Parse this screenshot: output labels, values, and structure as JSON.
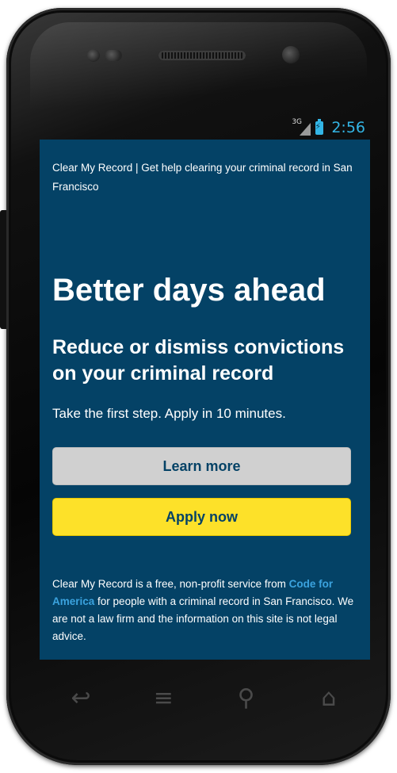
{
  "status_bar": {
    "network_label": "3G",
    "time": "2:56"
  },
  "page": {
    "top_line": "Clear My Record | Get help clearing your criminal record in San Francisco",
    "headline": "Better days ahead",
    "subheadline": "Reduce or dismiss convictions on your criminal record",
    "lead": "Take the first step. Apply in 10 minutes.",
    "buttons": {
      "learn_more": "Learn more",
      "apply_now": "Apply now"
    },
    "footer": {
      "before_link": "Clear My Record is a free, non-profit service from ",
      "link_text": "Code for America",
      "after_link": " for people with a criminal record in San Francisco. We are not a law firm and the information on this site is not legal advice."
    }
  },
  "nav_bar": {
    "icons": [
      "back-icon",
      "menu-icon",
      "search-icon",
      "home-icon"
    ]
  },
  "colors": {
    "screen_background": "#044266",
    "apply_button": "#fde129",
    "learn_button": "#d0d0d0",
    "link": "#3ba3df",
    "status_accent": "#33b5e5"
  }
}
